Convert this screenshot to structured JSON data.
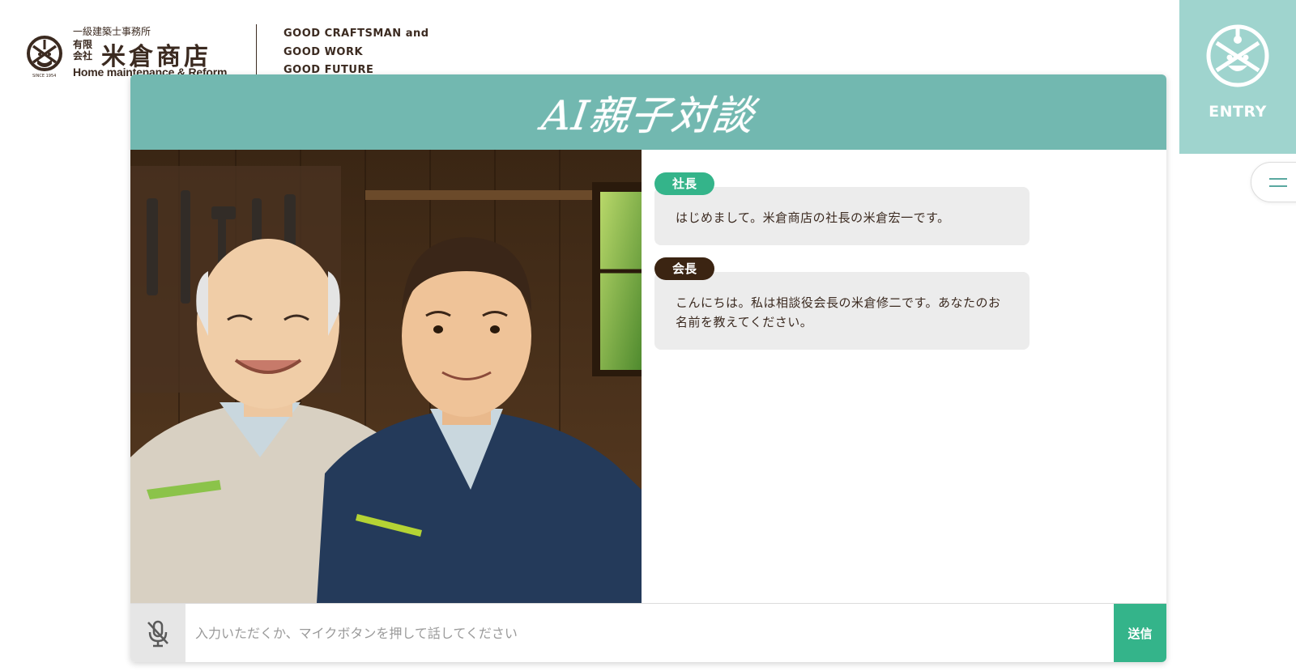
{
  "header": {
    "logo": {
      "small_label": "一級建築士事務所",
      "company_type": "有限会社",
      "name": "米倉商店",
      "subtitle": "Home maintenance & Reform",
      "since": "SINCE 1954"
    },
    "slogan": [
      "GOOD CRAFTSMAN and",
      "GOOD WORK",
      "GOOD FUTURE"
    ],
    "entry_label": "ENTRY"
  },
  "card": {
    "title": "AI親子対談"
  },
  "messages": [
    {
      "speaker": "社長",
      "text": "はじめまして。米倉商店の社長の米倉宏一です。"
    },
    {
      "speaker": "会長",
      "text": "こんにちは。私は相談役会長の米倉修二です。あなたのお名前を教えてください。"
    }
  ],
  "input": {
    "placeholder": "入力いただくか、マイクボタンを押して話してください",
    "value": "",
    "send_label": "送信"
  },
  "colors": {
    "accent_teal": "#72b8b0",
    "entry_teal": "#9fd4ce",
    "president_green": "#34b48a",
    "chairman_brown": "#3b2412",
    "text_brown": "#3b2a20"
  },
  "icons": [
    "logo-emblem-icon",
    "entry-emblem-icon",
    "menu-icon",
    "mic-off-icon"
  ]
}
